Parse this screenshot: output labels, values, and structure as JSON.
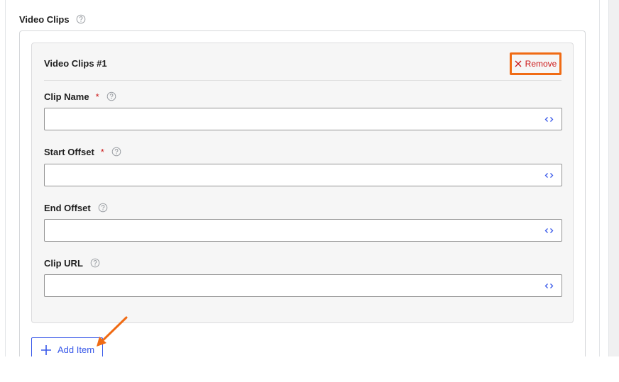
{
  "section": {
    "title": "Video Clips",
    "help_icon": "question-circle-icon"
  },
  "item": {
    "title": "Video Clips #1",
    "remove_label": "Remove",
    "remove_icon": "close-icon"
  },
  "fields": [
    {
      "label": "Clip Name",
      "required": "*",
      "value": "",
      "icon": "code-brackets-icon"
    },
    {
      "label": "Start Offset",
      "required": "*",
      "value": "",
      "icon": "code-brackets-icon"
    },
    {
      "label": "End Offset",
      "required": "",
      "value": "",
      "icon": "code-brackets-icon"
    },
    {
      "label": "Clip URL",
      "required": "",
      "value": "",
      "icon": "code-brackets-icon"
    }
  ],
  "add_item": {
    "label": "Add Item",
    "icon": "plus-icon"
  },
  "colors": {
    "highlight": "#f06b14",
    "accent_blue": "#3858e9",
    "danger": "#cc1818"
  }
}
